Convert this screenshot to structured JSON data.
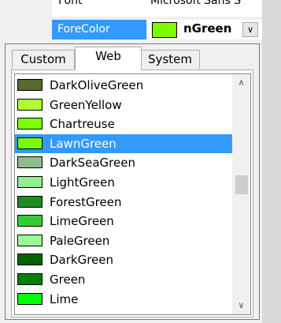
{
  "property_grid": {
    "font_row": {
      "name": "Font",
      "value": "Microsoft Sans S"
    },
    "forecolor_row": {
      "name": "ForeColor",
      "value": "nGreen",
      "swatch_color": "#7CFC00"
    }
  },
  "popup": {
    "tabs": [
      {
        "label": "Custom",
        "selected": false
      },
      {
        "label": "Web",
        "selected": true
      },
      {
        "label": "System",
        "selected": false
      }
    ],
    "colors": [
      {
        "label": "DarkOliveGreen",
        "color": "#556B2F"
      },
      {
        "label": "GreenYellow",
        "color": "#ADFF2F"
      },
      {
        "label": "Chartreuse",
        "color": "#7FFF00"
      },
      {
        "label": "LawnGreen",
        "color": "#7CFC00",
        "selected": true
      },
      {
        "label": "DarkSeaGreen",
        "color": "#8FBC8F"
      },
      {
        "label": "LightGreen",
        "color": "#90EE90"
      },
      {
        "label": "ForestGreen",
        "color": "#228B22"
      },
      {
        "label": "LimeGreen",
        "color": "#32CD32"
      },
      {
        "label": "PaleGreen",
        "color": "#98FB98"
      },
      {
        "label": "DarkGreen",
        "color": "#006400"
      },
      {
        "label": "Green",
        "color": "#008000"
      },
      {
        "label": "Lime",
        "color": "#00FF00"
      }
    ],
    "scroll_up_icon": "chevron-up-icon",
    "scroll_down_icon": "chevron-down-icon"
  },
  "colors": {
    "selection": "#3399FF"
  }
}
